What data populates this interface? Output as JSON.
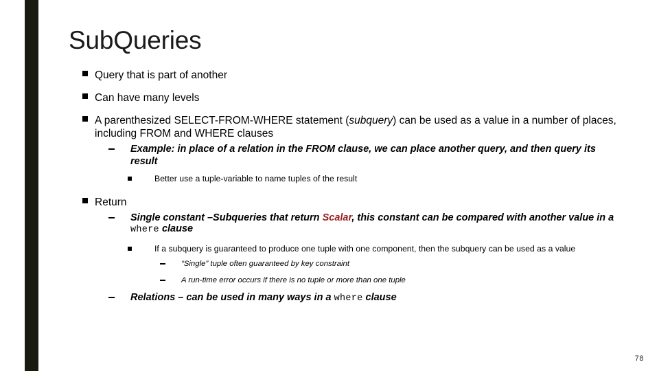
{
  "slide": {
    "title": "SubQueries",
    "page_number": "78",
    "accent_bar_color": "#191a10",
    "highlight_color": "#992222",
    "background_color": "#ffffff"
  },
  "bullets": {
    "b1": "Query that is part of another",
    "b2": " Can have many levels",
    "b3_part1": "A parenthesized SELECT-FROM-WHERE statement (",
    "b3_italic": "subquery",
    "b3_part2": ") can be used as a value in a number of places, including FROM and WHERE clauses",
    "b3_sub1": "Example: in place of a relation in the FROM clause, we can place another query, and then query its result",
    "b3_sub1_sub1": "Better use a tuple-variable to name tuples of the result",
    "b4": "Return",
    "b4_sub1_part1": "Single constant –Subqueries that return ",
    "b4_sub1_scalar": "Scalar",
    "b4_sub1_part2": ", this constant can be compared with another value in a ",
    "b4_sub1_code": "where",
    "b4_sub1_part3": " clause",
    "b4_sub1_sub1": "If a subquery is guaranteed to produce one tuple with one component, then the subquery can be used as a value",
    "b4_sub1_sub1_sub1": "“Single” tuple often guaranteed by key constraint",
    "b4_sub1_sub1_sub2": "A run-time error occurs if there is no tuple or more than one tuple",
    "b4_sub2_part1": "Relations – can be used in many ways in a ",
    "b4_sub2_code": "where",
    "b4_sub2_part2": " clause"
  }
}
